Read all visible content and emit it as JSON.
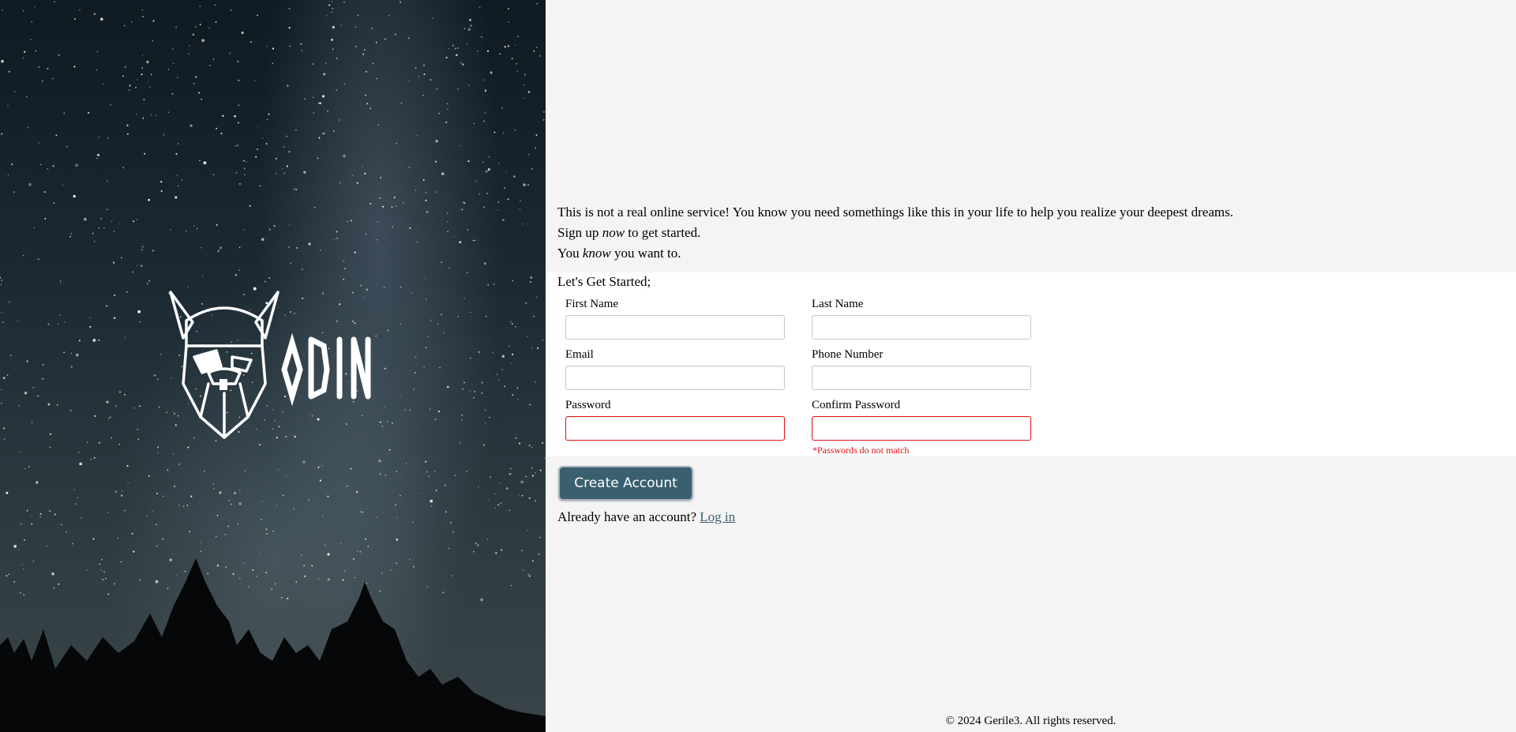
{
  "hero": {
    "logo_text": "ODIN",
    "logo_icon": "odin-viking-head-icon"
  },
  "intro": {
    "line1": "This is not a real online service! You know you need somethings like this in your life to help you realize your deepest dreams.",
    "line2_pre": "Sign up ",
    "line2_em": "now",
    "line2_post": " to get started.",
    "line3_pre": "You ",
    "line3_em": "know",
    "line3_post": " you want to."
  },
  "form": {
    "title": "Let's Get Started;",
    "fields": {
      "first_name": {
        "label": "First Name",
        "value": ""
      },
      "last_name": {
        "label": "Last Name",
        "value": ""
      },
      "email": {
        "label": "Email",
        "value": ""
      },
      "phone": {
        "label": "Phone Number",
        "value": ""
      },
      "password": {
        "label": "Password",
        "value": ""
      },
      "confirm_password": {
        "label": "Confirm Password",
        "value": ""
      }
    },
    "error_message": "*Passwords do not match",
    "error_color": "#e21010"
  },
  "actions": {
    "create_label": "Create Account",
    "login_prompt": "Already have an account? ",
    "login_link": "Log in",
    "accent_color": "#3a5f6f"
  },
  "footer": {
    "text": "© 2024 Gerile3. All rights reserved."
  }
}
